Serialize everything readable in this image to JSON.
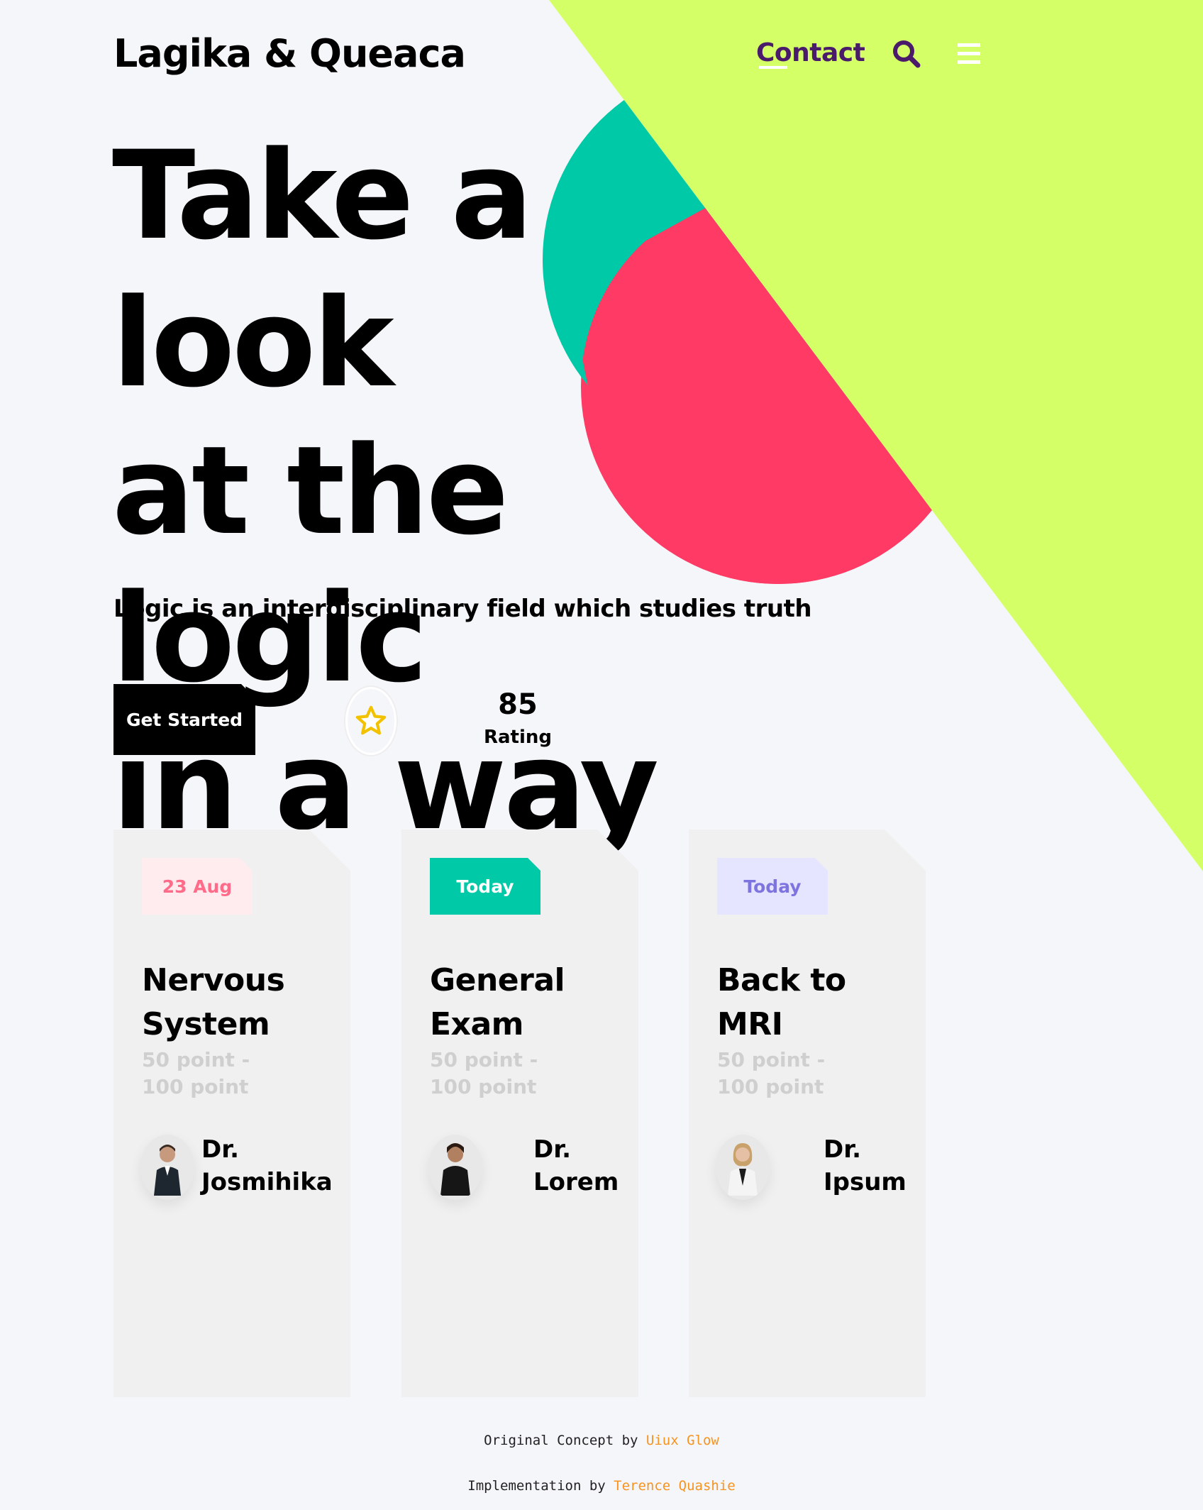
{
  "header": {
    "logo": "Lagika & Queaca",
    "contact_label": "Contact",
    "search_icon": "search-icon",
    "menu_icon": "hamburger-menu-icon"
  },
  "hero": {
    "title_lines": [
      "Take a look",
      "at the logic",
      "in a way"
    ],
    "subtitle": "Logic is an interdisciplinary field which studies truth"
  },
  "cta": {
    "button_label": "Get Started",
    "star_icon": "star-icon",
    "rating_value": "85",
    "rating_label": "Rating"
  },
  "cards": [
    {
      "tag": "23 Aug",
      "tag_bg": "#ffecef",
      "tag_color": "#ff6b88",
      "title_lines": [
        "Nervous",
        "System"
      ],
      "points": "50 point - 100 point",
      "doctor_lines": [
        "Dr.",
        "Josmihika"
      ]
    },
    {
      "tag": "Today",
      "tag_bg": "#00c9a7",
      "tag_color": "#ffffff",
      "title_lines": [
        "General",
        "Exam"
      ],
      "points": "50 point - 100 point",
      "doctor_lines": [
        "Dr.",
        "Lorem"
      ]
    },
    {
      "tag": "Today",
      "tag_bg": "#e6e5ff",
      "tag_color": "#7d74e0",
      "title_lines": [
        "Back to",
        "MRI"
      ],
      "points": "50 point - 100 point",
      "doctor_lines": [
        "Dr.",
        "Ipsum"
      ]
    }
  ],
  "footer": {
    "concept_prefix": "Original Concept by ",
    "concept_link": "Uiux Glow",
    "impl_prefix": "Implementation by ",
    "impl_link": "Terence Quashie"
  },
  "colors": {
    "lime": "#d4ff66",
    "teal": "#00c9a7",
    "pink": "#ff3a64",
    "contact": "#4a1a6b",
    "link": "#f7931e"
  }
}
